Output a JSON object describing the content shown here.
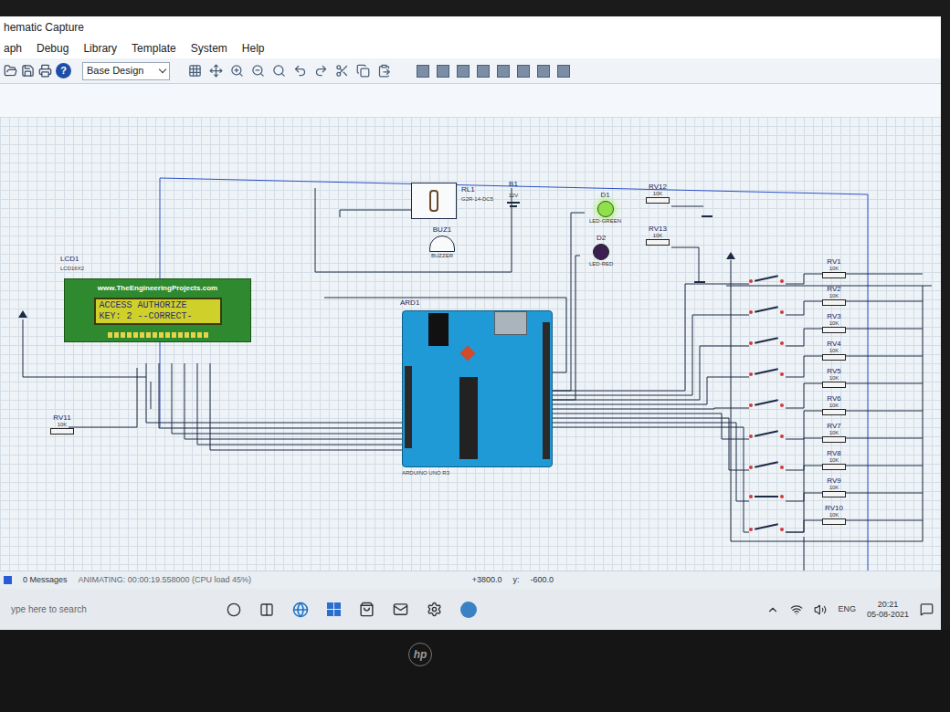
{
  "window": {
    "title": "hematic Capture"
  },
  "menu": [
    "aph",
    "Debug",
    "Library",
    "Template",
    "System",
    "Help"
  ],
  "toolbar": {
    "help": "?",
    "design_dropdown": "Base Design"
  },
  "schematic": {
    "lcd": {
      "ref": "LCD1",
      "part": "LCD16X2",
      "site": "www.TheEngineeringProjects.com",
      "lines": [
        "ACCESS AUTHORIZE",
        "KEY: 2 --CORRECT-"
      ]
    },
    "arduino": {
      "ref": "ARD1",
      "part": "ARDUINO UNO R3"
    },
    "relay": {
      "ref": "RL1",
      "part": "G2R-14-DC5"
    },
    "battery": {
      "ref": "B1",
      "value": "12V"
    },
    "buzzer": {
      "ref": "BUZ1",
      "part": "BUZZER"
    },
    "leds": [
      {
        "ref": "D1",
        "part": "LED-GREEN",
        "on": true,
        "color": "#8fe04a"
      },
      {
        "ref": "D2",
        "part": "LED-RED",
        "on": false,
        "color": "#3b1f4f"
      }
    ],
    "side_pots": [
      {
        "ref": "RV12",
        "value": "10K"
      },
      {
        "ref": "RV13",
        "value": "10K"
      }
    ],
    "contrast_pot": {
      "ref": "RV11",
      "value": "10K"
    },
    "keypad_pots": [
      {
        "ref": "RV1",
        "value": "10K"
      },
      {
        "ref": "RV2",
        "value": "10K"
      },
      {
        "ref": "RV3",
        "value": "10K"
      },
      {
        "ref": "RV4",
        "value": "10K"
      },
      {
        "ref": "RV5",
        "value": "10K"
      },
      {
        "ref": "RV6",
        "value": "10K"
      },
      {
        "ref": "RV7",
        "value": "10K"
      },
      {
        "ref": "RV8",
        "value": "10K"
      },
      {
        "ref": "RV9",
        "value": "10K"
      },
      {
        "ref": "RV10",
        "value": "10K"
      }
    ],
    "switches": [
      {
        "pressed": false
      },
      {
        "pressed": false
      },
      {
        "pressed": false
      },
      {
        "pressed": false
      },
      {
        "pressed": false
      },
      {
        "pressed": false
      },
      {
        "pressed": false
      },
      {
        "pressed": true
      },
      {
        "pressed": false
      }
    ]
  },
  "status_bar": {
    "messages": "0 Messages",
    "status": "ANIMATING: 00:00:19.558000 (CPU load 45%)",
    "x": "+3800.0",
    "y_label": "y:",
    "y": "-600.0"
  },
  "taskbar": {
    "search": "ype here to search",
    "language": "ENG",
    "time": "20:21",
    "date": "05-08-2021"
  },
  "laptop": {
    "brand": "hp"
  }
}
